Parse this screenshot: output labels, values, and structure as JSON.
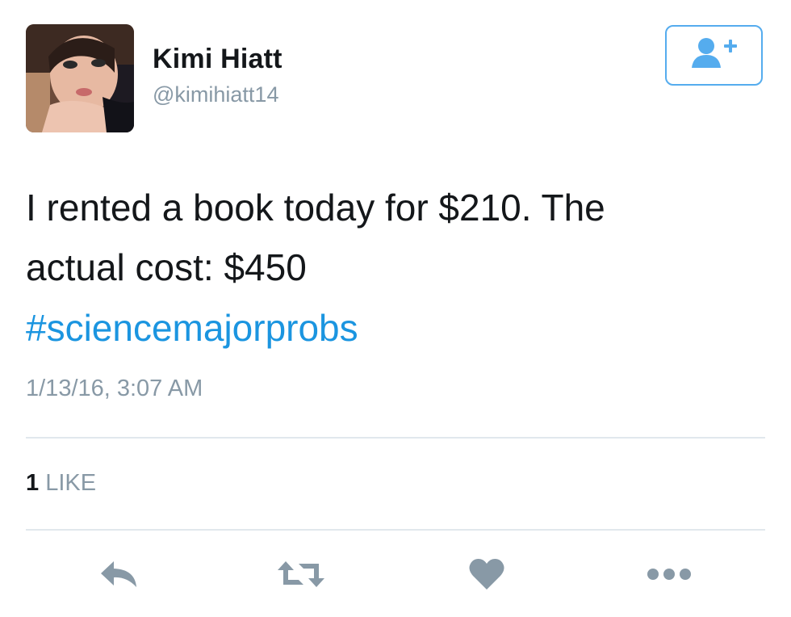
{
  "author": {
    "display_name": "Kimi Hiatt",
    "handle": "@kimihiatt14"
  },
  "follow_button": {
    "icon": "add-user-icon"
  },
  "tweet": {
    "text_lines": [
      "I rented a book today for $210. The",
      "actual cost: $450"
    ],
    "hashtag": "#sciencemajorprobs",
    "timestamp": "1/13/16, 3:07 AM"
  },
  "stats": {
    "likes_count": "1",
    "likes_label": "LIKE"
  },
  "actions": {
    "reply_icon": "reply-icon",
    "retweet_icon": "retweet-icon",
    "like_icon": "heart-icon",
    "more_icon": "more-icon"
  },
  "colors": {
    "accent": "#1b95e0",
    "muted": "#8899a6",
    "divider": "#e1e8ed",
    "follow_border": "#55acee"
  }
}
